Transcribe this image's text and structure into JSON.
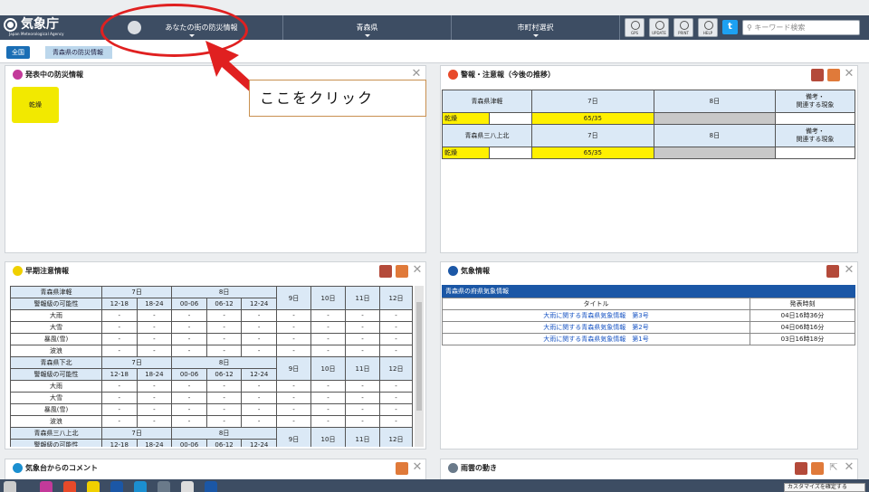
{
  "header": {
    "logo_name": "気象庁",
    "logo_sub": "Japan Meteorological Agency",
    "nav": [
      "あなたの街の防災情報",
      "青森県",
      "市町村選択"
    ],
    "tools": [
      "GPS",
      "UPDATE",
      "PRINT",
      "HELP"
    ],
    "search_placeholder": "キーワード検索"
  },
  "breadcrumb": [
    "全国",
    "青森県の防災情報"
  ],
  "callout": "ここをクリック",
  "panel_current": {
    "title": "発表中の防災情報",
    "badge": "乾燥"
  },
  "panel_warning": {
    "title": "警報・注意報（今後の推移）",
    "blocks": [
      {
        "area": "青森県津軽",
        "d1": "7日",
        "d2": "8日",
        "note": "備考・\n関連する現象",
        "item": "乾燥",
        "value": "65/35"
      },
      {
        "area": "青森県三八上北",
        "d1": "7日",
        "d2": "8日",
        "note": "備考・\n関連する現象",
        "item": "乾燥",
        "value": "65/35"
      }
    ]
  },
  "panel_early": {
    "title": "早期注意情報",
    "days": [
      "7日",
      "8日",
      "9日",
      "10日",
      "11日",
      "12日"
    ],
    "times": [
      "12-18",
      "18-24",
      "00-06",
      "06-12",
      "12-24"
    ],
    "possibility": "警報級の可能性",
    "rows": [
      "大雨",
      "大雪",
      "暴風(雪)",
      "波浪"
    ],
    "dash": "-",
    "areas": [
      "青森県津軽",
      "青森県下北",
      "青森県三八上北"
    ]
  },
  "panel_weather": {
    "title": "気象情報",
    "caption": "青森県の府県気象情報",
    "col_title": "タイトル",
    "col_time": "発表時刻",
    "rows": [
      {
        "title": "大雨に関する青森県気象情報　第3号",
        "time": "04日16時36分"
      },
      {
        "title": "大雨に関する青森県気象情報　第2号",
        "time": "04日06時16分"
      },
      {
        "title": "大雨に関する青森県気象情報　第1号",
        "time": "03日16時18分"
      }
    ]
  },
  "panel_comment": {
    "title": "気象台からのコメント"
  },
  "panel_rain": {
    "title": "雨雲の動き"
  },
  "customize": "カスタマイズを確定する"
}
